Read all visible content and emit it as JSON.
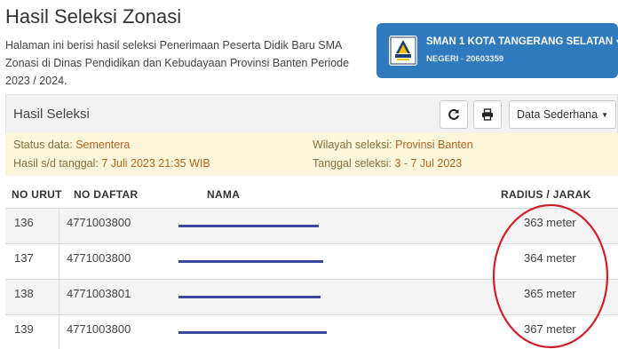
{
  "header": {
    "title": "Hasil Seleksi Zonasi",
    "description": "Halaman ini berisi hasil seleksi Penerimaan Peserta Didik Baru SMA Zonasi di Dinas Pendidikan dan Kebudayaan Provinsi Banten Periode 2023 / 2024."
  },
  "school": {
    "name": "SMAN 1 KOTA TANGERANG SELATAN",
    "npsn": "NEGERI - 20603359"
  },
  "panel": {
    "title": "Hasil Seleksi",
    "view_label": "Data Sederhana"
  },
  "status": {
    "status_label": "Status data:",
    "status_value": "Sementera",
    "hasil_label": "Hasil s/d tanggal:",
    "hasil_value": "7 Juli 2023 21:35 WIB",
    "wilayah_label": "Wilayah seleksi:",
    "wilayah_value": "Provinsi Banten",
    "tanggal_label": "Tanggal seleksi:",
    "tanggal_value": "3 - 7 Jul 2023"
  },
  "table": {
    "columns": [
      "NO URUT",
      "NO DAFTAR",
      "NAMA",
      "RADIUS / JARAK"
    ],
    "rows": [
      {
        "no": "136",
        "daftar": "4771003800",
        "jarak": "363 meter"
      },
      {
        "no": "137",
        "daftar": "4771003800",
        "jarak": "364 meter"
      },
      {
        "no": "138",
        "daftar": "4771003801",
        "jarak": "365 meter"
      },
      {
        "no": "139",
        "daftar": "4771003800",
        "jarak": "367 meter"
      }
    ]
  },
  "colors": {
    "accent": "#2f79bd",
    "warning_bg": "#fbf6dc",
    "highlight": "#d0202a",
    "redaction": "#3a46a0"
  }
}
